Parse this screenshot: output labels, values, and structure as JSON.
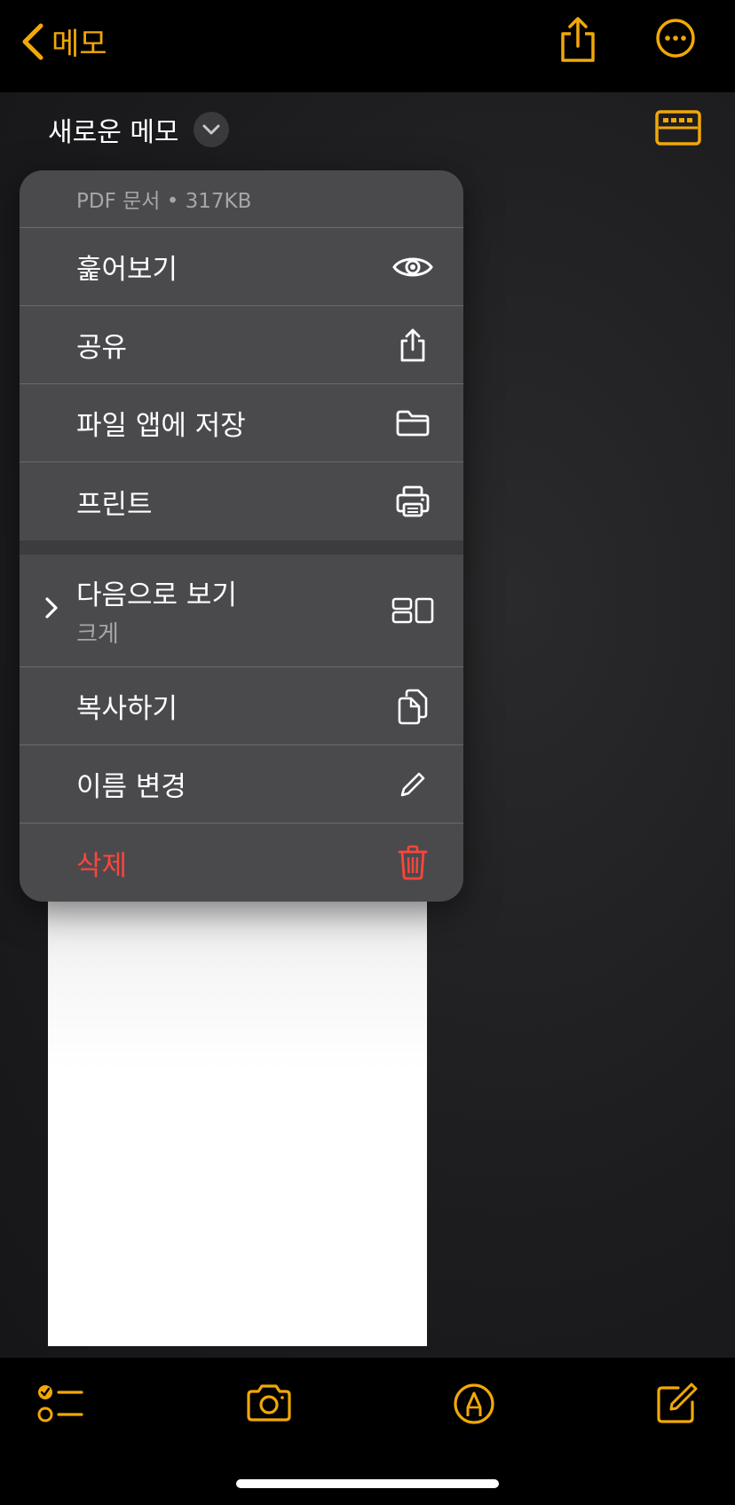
{
  "nav": {
    "back_label": "메모"
  },
  "note": {
    "title": "새로운 메모"
  },
  "menu": {
    "header": "PDF 문서 • 317KB",
    "items": [
      {
        "label": "훑어보기",
        "icon": "eye-icon"
      },
      {
        "label": "공유",
        "icon": "share-icon"
      },
      {
        "label": "파일 앱에 저장",
        "icon": "folder-icon"
      },
      {
        "label": "프린트",
        "icon": "printer-icon"
      }
    ],
    "view_as": {
      "label": "다음으로 보기",
      "value": "크게",
      "icon": "view-layout-icon"
    },
    "items2": [
      {
        "label": "복사하기",
        "icon": "copy-icon"
      },
      {
        "label": "이름 변경",
        "icon": "pencil-icon"
      },
      {
        "label": "삭제",
        "icon": "trash-icon"
      }
    ]
  },
  "colors": {
    "accent": "#f1a807",
    "destructive": "#ff453a",
    "menu_bg": "#4a4a4d"
  }
}
